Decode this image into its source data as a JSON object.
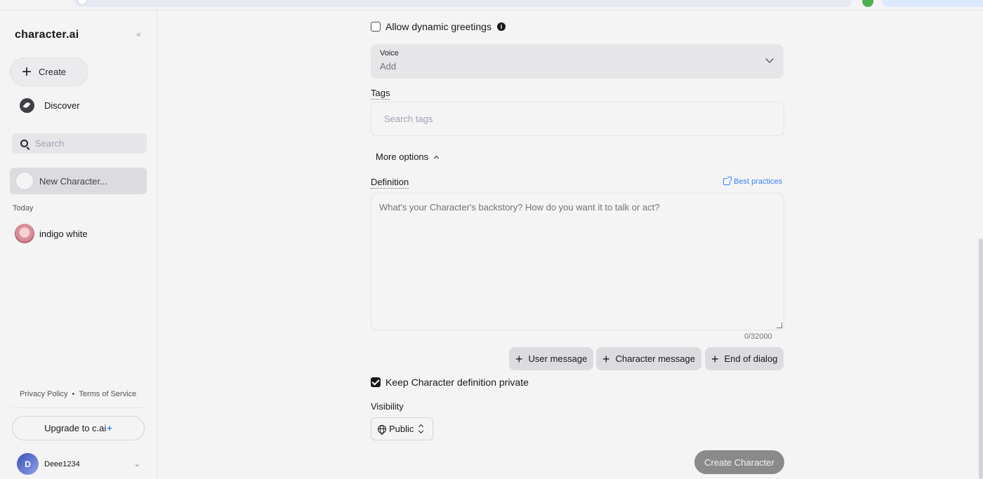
{
  "sidebar": {
    "logo": "character.ai",
    "collapse_icon": "«",
    "create_label": "Create",
    "discover_label": "Discover",
    "search_placeholder": "Search",
    "new_character_label": "New Character...",
    "section_today": "Today",
    "chats": [
      {
        "name": "indigo white"
      }
    ],
    "legal": {
      "privacy": "Privacy Policy",
      "separator": "•",
      "terms": "Terms of Service"
    },
    "upgrade_label": "Upgrade to c.ai",
    "upgrade_plus": "+",
    "user": {
      "initial": "D",
      "name": "Deee1234"
    }
  },
  "form": {
    "dynamic_greetings": {
      "label": "Allow dynamic greetings",
      "checked": false,
      "info_icon": "i"
    },
    "voice": {
      "title": "Voice",
      "value": "Add"
    },
    "tags": {
      "label": "Tags",
      "placeholder": "Search tags"
    },
    "more_options_label": "More options",
    "definition": {
      "label": "Definition",
      "best_practices": "Best practices",
      "placeholder": "What's your Character's backstory? How do you want it to talk or act?",
      "count": "0/32000"
    },
    "insert_buttons": [
      {
        "label": "User message"
      },
      {
        "label": "Character message"
      },
      {
        "label": "End of dialog"
      }
    ],
    "keep_private": {
      "label": "Keep Character definition private",
      "checked": true
    },
    "visibility": {
      "label": "Visibility",
      "value": "Public"
    },
    "submit_label": "Create Character"
  },
  "colors": {
    "background": "#f4f4f5",
    "link_blue": "#3b82f6",
    "submit_disabled": "#8a8a8a"
  }
}
